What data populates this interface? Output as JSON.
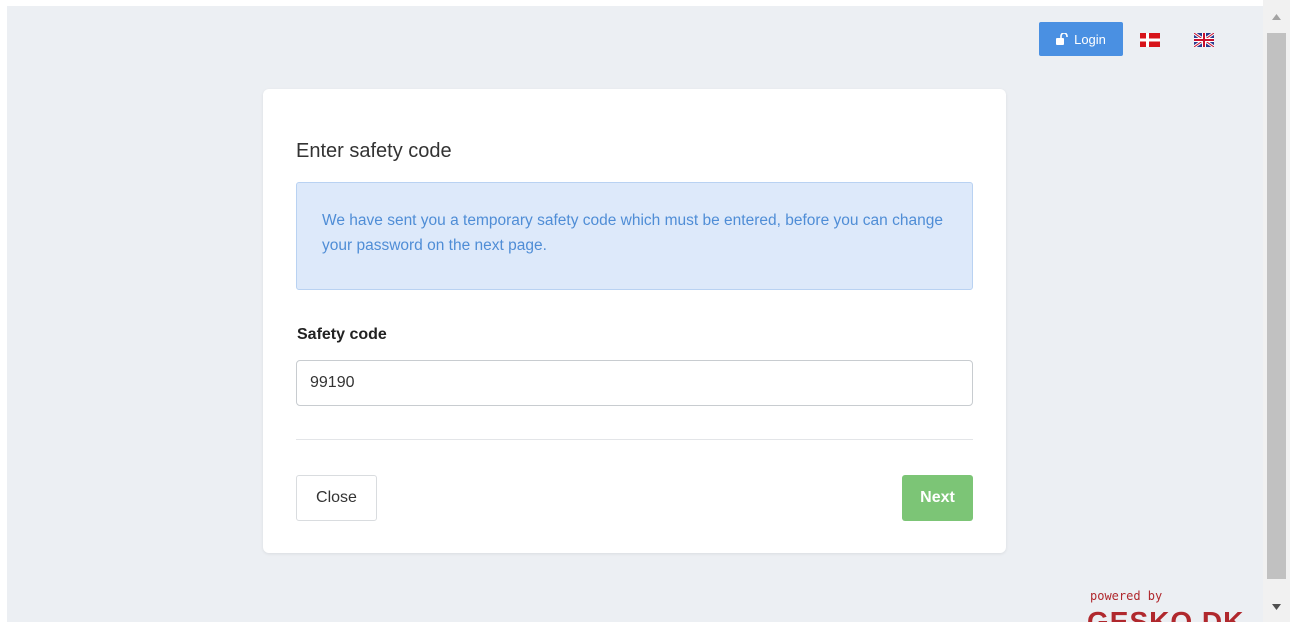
{
  "header": {
    "login_label": "Login",
    "lock_icon": "unlock-icon",
    "languages": [
      {
        "code": "da",
        "icon": "danish-flag-icon"
      },
      {
        "code": "en",
        "icon": "uk-flag-icon"
      }
    ]
  },
  "dialog": {
    "title": "Enter safety code",
    "info_text": "We have sent you a temporary safety code which must be entered, before you can change your password on the next page.",
    "field_label": "Safety code",
    "field_value": "99190",
    "close_label": "Close",
    "next_label": "Next"
  },
  "footer": {
    "powered_by": "powered by",
    "brand": "GESKO.DK"
  },
  "colors": {
    "page_bg": "#eceff3",
    "login_blue": "#4a90e2",
    "info_bg": "#dde9fa",
    "info_text": "#4f8dd6",
    "next_green": "#7cc576",
    "brand_red": "#b0282d"
  }
}
